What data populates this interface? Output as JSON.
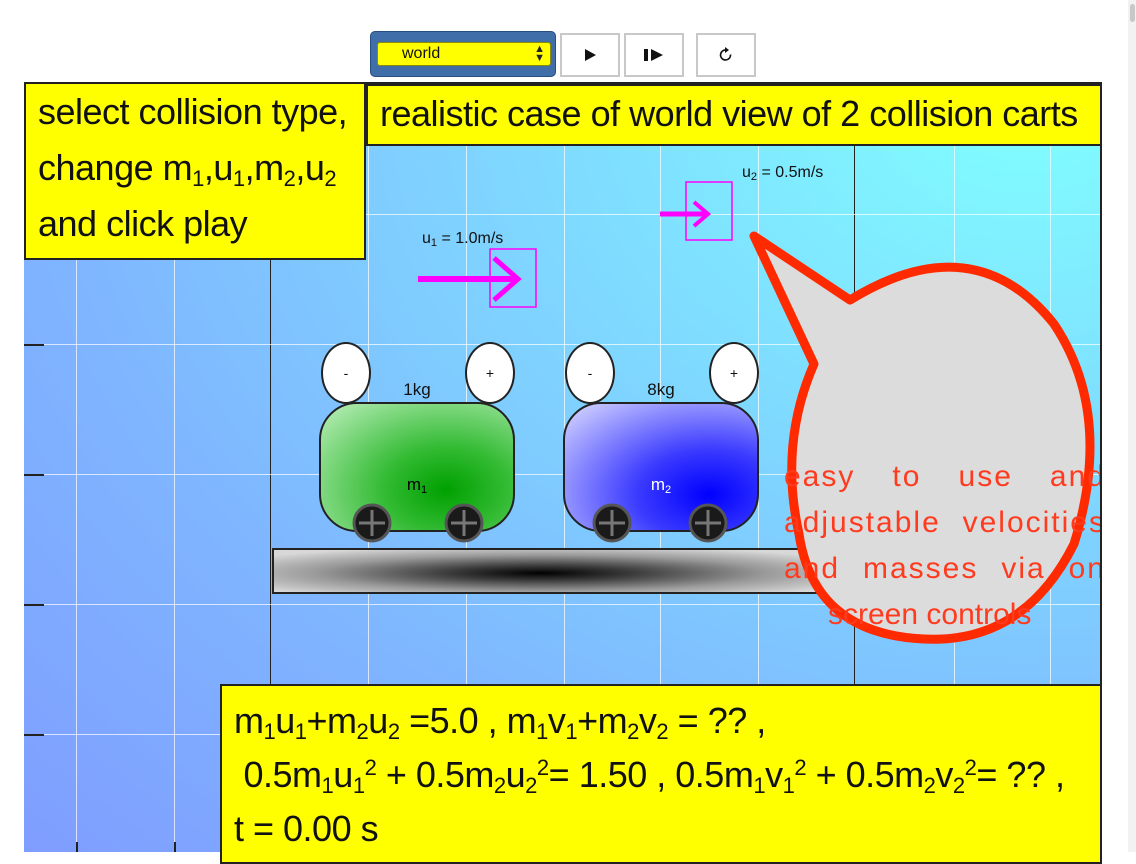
{
  "toolbar": {
    "view_select": {
      "selected": "world"
    },
    "play_icon": "play-icon",
    "step_icon": "step-forward-icon",
    "reset_icon": "reset-icon"
  },
  "instructions": {
    "line1": "select collision type,",
    "line2_prefix": " change m",
    "line2_sub1": "1",
    "line2_u": ",u",
    "line2_sub2": "1",
    "line2_m2": ",m",
    "line2_sub3": "2",
    "line2_u2": ",u",
    "line2_sub4": "2",
    "line3": "and click play"
  },
  "title": "realistic case of world view of 2 collision carts",
  "carts": [
    {
      "mass": "1kg",
      "label": "m",
      "label_sub": "1",
      "minus": "-",
      "plus": "+"
    },
    {
      "mass": "8kg",
      "label": "m",
      "label_sub": "2",
      "minus": "-",
      "plus": "+"
    }
  ],
  "velocities": {
    "u1": {
      "sym": "u",
      "sub": "1",
      "value": " = 1.0m/s"
    },
    "u2": {
      "sym": "u",
      "sub": "2",
      "value": " = 0.5m/s"
    }
  },
  "callout": {
    "line1": "easy to use and",
    "line2": "adjustable velocities",
    "line3": "and masses via on",
    "line4": "screen controls"
  },
  "equations": {
    "momentum_before_value": "5.0",
    "momentum_after_value": "??",
    "ke_before_value": "1.50",
    "ke_after_value": "??",
    "time_label": "t = ",
    "time_value": "0.00",
    "time_unit": " s"
  },
  "colors": {
    "panel": "#ffff00",
    "cart1": "#00a000",
    "cart2": "#0000ff",
    "arrow": "#ff00ff",
    "callout": "#ff2a00"
  }
}
